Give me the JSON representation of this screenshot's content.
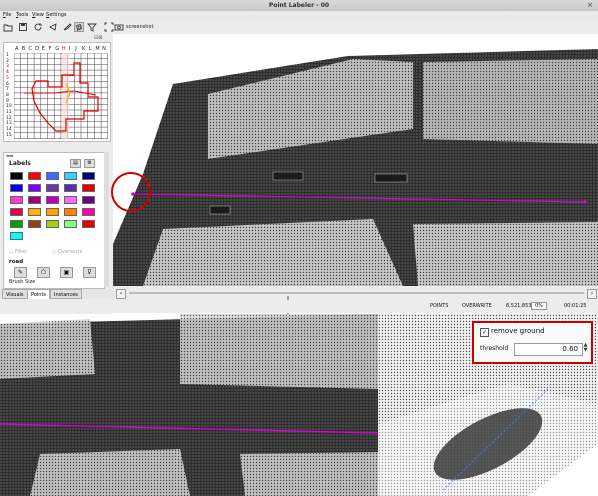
{
  "window": {
    "title": "Point Labeler - 00",
    "close_glyph": "×"
  },
  "menu": [
    "File",
    "Tools",
    "View",
    "Settings"
  ],
  "toolbar": {
    "icons": [
      "open-folder-icon",
      "save-icon",
      "reload-icon",
      "polygon-select-icon",
      "brush-icon",
      "filter-icon",
      "crop-icon",
      "camera-icon"
    ],
    "screenshot_label": "screenshot"
  },
  "tile_grid": {
    "columns": [
      "A",
      "B",
      "C",
      "D",
      "E",
      "F",
      "G",
      "H",
      "I",
      "J",
      "K",
      "L",
      "M",
      "N"
    ],
    "rows": [
      "1",
      "2",
      "3",
      "4",
      "5",
      "6",
      "7",
      "8",
      "9",
      "10",
      "11",
      "12",
      "13",
      "14",
      "15"
    ],
    "highlight_column": "H",
    "highlight_row": "5"
  },
  "labels_panel": {
    "title": "Labels",
    "colors": [
      "#000000",
      "#ff0000",
      "#3a6fff",
      "#2fd4ff",
      "#00007f",
      "#0000ff",
      "#7a00ff",
      "#6b3aa5",
      "#5a2db0",
      "#e60000",
      "#ff3cc8",
      "#a0007a",
      "#c000c0",
      "#ff66ff",
      "#6b0080",
      "#e6004c",
      "#ffb000",
      "#ffa000",
      "#ff8000",
      "#ff00aa",
      "#00a000",
      "#8b4513",
      "#a0d010",
      "#80ff80",
      "#e60000",
      "#00ffff"
    ],
    "radio_filter": "Filter",
    "radio_overwrite": "Overwrite",
    "selected_label": "road",
    "brush_size_label": "Brush Size"
  },
  "tabs": [
    {
      "label": "Visuals",
      "active": false
    },
    {
      "label": "Points",
      "active": true
    },
    {
      "label": "Instances",
      "active": false
    }
  ],
  "status": {
    "points_label": "POINTS",
    "overwrite_label": "OVERWRITE",
    "points_value": "8,521,853",
    "percent": "0%",
    "time": "00:01:25"
  },
  "ground_panel": {
    "checkbox_label": "remove ground",
    "checked": true,
    "threshold_label": "threshold",
    "threshold_value": "0.60"
  },
  "colors": {
    "annotation_red": "#cc0000",
    "line_magenta": "#d400d4"
  }
}
